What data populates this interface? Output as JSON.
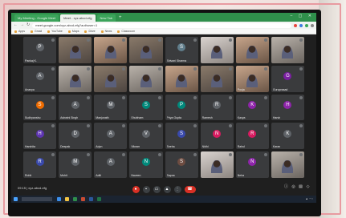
{
  "browser": {
    "tabs": [
      {
        "label": "My Meeting - Google Meet",
        "active": false
      },
      {
        "label": "Meet - xyz-abcd-efg",
        "active": true
      },
      {
        "label": "New Tab",
        "active": false
      }
    ],
    "url": "meet.google.com/xyz-abcd-efg?authuser=1",
    "bookmarks": [
      "Apps",
      "Gmail",
      "YouTube",
      "Maps",
      "Drive",
      "News",
      "Classroom"
    ]
  },
  "meeting": {
    "info": "09:15  |  xyz-abcd-efg",
    "participants": [
      {
        "name": "Pankaj K.",
        "type": "avatar",
        "color": "#5f6368"
      },
      {
        "name": "",
        "type": "video",
        "style": "v1"
      },
      {
        "name": "",
        "type": "video",
        "style": "v3"
      },
      {
        "name": "",
        "type": "video",
        "style": "v1"
      },
      {
        "name": "Shivani Sharma",
        "type": "avatar",
        "color": "#607d8b"
      },
      {
        "name": "",
        "type": "video",
        "style": "v4"
      },
      {
        "name": "",
        "type": "video",
        "style": "v3"
      },
      {
        "name": "",
        "type": "video",
        "style": "v2"
      },
      {
        "name": "Ananya",
        "type": "avatar",
        "color": "#5f6368"
      },
      {
        "name": "",
        "type": "video",
        "style": "v2"
      },
      {
        "name": "",
        "type": "video",
        "style": "v1"
      },
      {
        "name": "",
        "type": "video",
        "style": "v2"
      },
      {
        "name": "",
        "type": "video",
        "style": "v3"
      },
      {
        "name": "",
        "type": "video",
        "style": "v1"
      },
      {
        "name": "Pooja",
        "type": "video",
        "style": "v3"
      },
      {
        "name": "Guruprasad",
        "type": "avatar",
        "color": "#7b1fa2"
      },
      {
        "name": "Sudhyanshu",
        "type": "avatar",
        "color": "#ef6c00"
      },
      {
        "name": "Ashwini Singh",
        "type": "avatar",
        "color": "#5f6368"
      },
      {
        "name": "Manjunath",
        "type": "avatar",
        "color": "#5f6368"
      },
      {
        "name": "Shubham",
        "type": "avatar",
        "color": "#00897b"
      },
      {
        "name": "Priya Gupta",
        "type": "avatar",
        "color": "#00897b"
      },
      {
        "name": "Ramesh",
        "type": "avatar",
        "color": "#5f6368"
      },
      {
        "name": "Kavya",
        "type": "avatar",
        "color": "#8e24aa"
      },
      {
        "name": "Harsh",
        "type": "avatar",
        "color": "#8e24aa"
      },
      {
        "name": "Harshita",
        "type": "avatar",
        "color": "#5e35b1"
      },
      {
        "name": "Deepak",
        "type": "avatar",
        "color": "#5f6368"
      },
      {
        "name": "Arjun",
        "type": "avatar",
        "color": "#5f6368"
      },
      {
        "name": "Vikram",
        "type": "avatar",
        "color": "#5f6368"
      },
      {
        "name": "Sneha",
        "type": "avatar",
        "color": "#3949ab"
      },
      {
        "name": "Nidhi",
        "type": "avatar",
        "color": "#d81b60"
      },
      {
        "name": "Rahul",
        "type": "avatar",
        "color": "#d81b60"
      },
      {
        "name": "Karan",
        "type": "avatar",
        "color": "#5f6368"
      },
      {
        "name": "Rohit",
        "type": "avatar",
        "color": "#3949ab"
      },
      {
        "name": "Mohit",
        "type": "avatar",
        "color": "#5f6368"
      },
      {
        "name": "Aditi",
        "type": "avatar",
        "color": "#5f6368"
      },
      {
        "name": "Naveen",
        "type": "avatar",
        "color": "#00897b"
      },
      {
        "name": "Sapna",
        "type": "avatar",
        "color": "#6d4c41"
      },
      {
        "name": "",
        "type": "video",
        "style": "v4"
      },
      {
        "name": "Neha",
        "type": "avatar",
        "color": "#8e24aa"
      },
      {
        "name": "",
        "type": "video",
        "style": "v2"
      }
    ]
  },
  "colors": {
    "chrome_green": "#2f8f4b",
    "end_call_red": "#d93025",
    "meet_bg": "#1f1f1f"
  }
}
